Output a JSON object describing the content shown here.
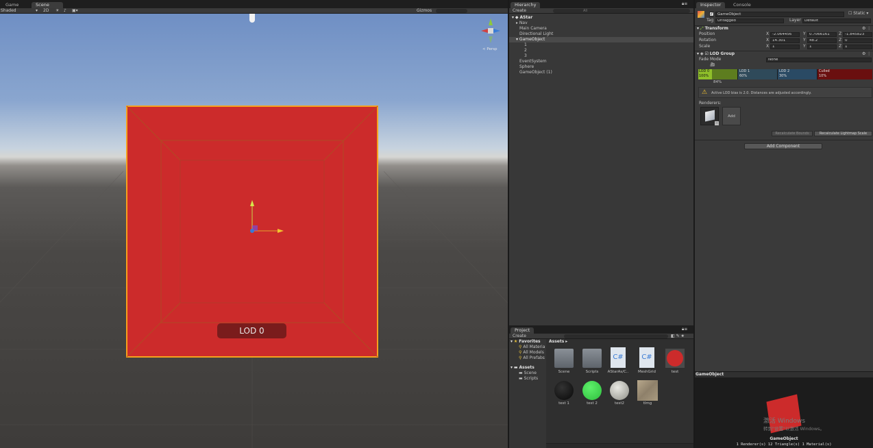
{
  "scene_panel": {
    "tabs": {
      "game": "Game",
      "scene": "Scene"
    },
    "toolbar": {
      "shading": "Shaded",
      "mode_2d": "2D",
      "gizmos": "Gizmos",
      "search": "All"
    },
    "persp_label": "< Persp",
    "lod_label": "LOD 0",
    "colors": {
      "sky_top": "#6d8fc4",
      "ground": "#3f3d3b",
      "cube": "#cc2b2b",
      "outline": "#f6a21d"
    }
  },
  "hierarchy": {
    "tab": "Hierarchy",
    "create": "Create",
    "search": "All",
    "scene_name": "AStar",
    "items": [
      "Nav",
      "Main Camera",
      "Directional Light",
      "GameObject",
      "1",
      "2",
      "3",
      "EventSystem",
      "Sphere",
      "GameObject (1)"
    ]
  },
  "project": {
    "tab": "Project",
    "create": "Create",
    "favorites_label": "Favorites",
    "favorites": [
      "All Materia",
      "All Models",
      "All Prefabs"
    ],
    "assets_label": "Assets",
    "asset_folders": [
      "Scene",
      "Scripts"
    ],
    "breadcrumb": "Assets",
    "assets": [
      {
        "name": "Scene",
        "kind": "folder-icon"
      },
      {
        "name": "Scripts",
        "kind": "folder-icon"
      },
      {
        "name": "AStarAs/C..",
        "kind": "script-icon"
      },
      {
        "name": "MeshGrid",
        "kind": "script-icon"
      },
      {
        "name": "test",
        "kind": "red-material-icon"
      },
      {
        "name": "test 1",
        "kind": "black-material-icon"
      },
      {
        "name": "test 2",
        "kind": "green-material-icon"
      },
      {
        "name": "test2",
        "kind": "marble-material-icon"
      },
      {
        "name": "tlmg",
        "kind": "texture-icon"
      }
    ]
  },
  "inspector": {
    "tabs": {
      "inspector": "Inspector",
      "console": "Console"
    },
    "object_name": "GameObject",
    "static_label": "Static",
    "tag_label": "Tag",
    "tag_value": "Untagged",
    "layer_label": "Layer",
    "layer_value": "Default",
    "transform": {
      "title": "Transform",
      "position": {
        "label": "Position",
        "x": "-2.064456",
        "y": "0.7066161",
        "z": "-1.845823"
      },
      "rotation": {
        "label": "Rotation",
        "x": "14.301",
        "y": "48.2",
        "z": "0"
      },
      "scale": {
        "label": "Scale",
        "x": "1",
        "y": "1",
        "z": "1"
      }
    },
    "lod_group": {
      "title": "LOD Group",
      "fade_mode_label": "Fade Mode",
      "fade_mode_value": "None",
      "levels": [
        {
          "name": "LOD 0",
          "percent": "100%",
          "color": "#5d7d1f"
        },
        {
          "name": "LOD 1",
          "percent": "60%",
          "color": "#2f4a5a"
        },
        {
          "name": "LOD 2",
          "percent": "30%",
          "color": "#2a4a64"
        },
        {
          "name": "Culled",
          "percent": "10%",
          "color": "#6a0f0f"
        }
      ],
      "current_percent": "84%",
      "warning": "Active LOD bias is 2.0. Distances are adjusted accordingly.",
      "renderers_label": "Renderers:",
      "add_label": "Add",
      "recalc_bounds": "Recalculate Bounds",
      "recalc_lightmap": "Recalculate Lightmap Scale"
    },
    "add_component": "Add Component"
  },
  "preview": {
    "title": "GameObject",
    "watermark_line1": "激活 Windows",
    "watermark_line2": "转到\"设置\"以激活 Windows。",
    "caption": "GameObject",
    "stats": "1 Renderer(s)  12 Triangle(s)  1 Material(s)"
  }
}
